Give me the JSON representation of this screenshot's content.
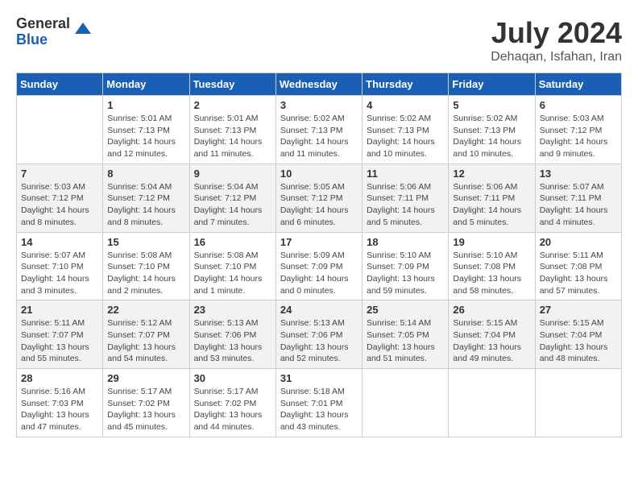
{
  "header": {
    "logo_general": "General",
    "logo_blue": "Blue",
    "month_year": "July 2024",
    "location": "Dehaqan, Isfahan, Iran"
  },
  "calendar": {
    "days_of_week": [
      "Sunday",
      "Monday",
      "Tuesday",
      "Wednesday",
      "Thursday",
      "Friday",
      "Saturday"
    ],
    "weeks": [
      [
        {
          "day": "",
          "info": ""
        },
        {
          "day": "1",
          "info": "Sunrise: 5:01 AM\nSunset: 7:13 PM\nDaylight: 14 hours\nand 12 minutes."
        },
        {
          "day": "2",
          "info": "Sunrise: 5:01 AM\nSunset: 7:13 PM\nDaylight: 14 hours\nand 11 minutes."
        },
        {
          "day": "3",
          "info": "Sunrise: 5:02 AM\nSunset: 7:13 PM\nDaylight: 14 hours\nand 11 minutes."
        },
        {
          "day": "4",
          "info": "Sunrise: 5:02 AM\nSunset: 7:13 PM\nDaylight: 14 hours\nand 10 minutes."
        },
        {
          "day": "5",
          "info": "Sunrise: 5:02 AM\nSunset: 7:13 PM\nDaylight: 14 hours\nand 10 minutes."
        },
        {
          "day": "6",
          "info": "Sunrise: 5:03 AM\nSunset: 7:12 PM\nDaylight: 14 hours\nand 9 minutes."
        }
      ],
      [
        {
          "day": "7",
          "info": "Sunrise: 5:03 AM\nSunset: 7:12 PM\nDaylight: 14 hours\nand 8 minutes."
        },
        {
          "day": "8",
          "info": "Sunrise: 5:04 AM\nSunset: 7:12 PM\nDaylight: 14 hours\nand 8 minutes."
        },
        {
          "day": "9",
          "info": "Sunrise: 5:04 AM\nSunset: 7:12 PM\nDaylight: 14 hours\nand 7 minutes."
        },
        {
          "day": "10",
          "info": "Sunrise: 5:05 AM\nSunset: 7:12 PM\nDaylight: 14 hours\nand 6 minutes."
        },
        {
          "day": "11",
          "info": "Sunrise: 5:06 AM\nSunset: 7:11 PM\nDaylight: 14 hours\nand 5 minutes."
        },
        {
          "day": "12",
          "info": "Sunrise: 5:06 AM\nSunset: 7:11 PM\nDaylight: 14 hours\nand 5 minutes."
        },
        {
          "day": "13",
          "info": "Sunrise: 5:07 AM\nSunset: 7:11 PM\nDaylight: 14 hours\nand 4 minutes."
        }
      ],
      [
        {
          "day": "14",
          "info": "Sunrise: 5:07 AM\nSunset: 7:10 PM\nDaylight: 14 hours\nand 3 minutes."
        },
        {
          "day": "15",
          "info": "Sunrise: 5:08 AM\nSunset: 7:10 PM\nDaylight: 14 hours\nand 2 minutes."
        },
        {
          "day": "16",
          "info": "Sunrise: 5:08 AM\nSunset: 7:10 PM\nDaylight: 14 hours\nand 1 minute."
        },
        {
          "day": "17",
          "info": "Sunrise: 5:09 AM\nSunset: 7:09 PM\nDaylight: 14 hours\nand 0 minutes."
        },
        {
          "day": "18",
          "info": "Sunrise: 5:10 AM\nSunset: 7:09 PM\nDaylight: 13 hours\nand 59 minutes."
        },
        {
          "day": "19",
          "info": "Sunrise: 5:10 AM\nSunset: 7:08 PM\nDaylight: 13 hours\nand 58 minutes."
        },
        {
          "day": "20",
          "info": "Sunrise: 5:11 AM\nSunset: 7:08 PM\nDaylight: 13 hours\nand 57 minutes."
        }
      ],
      [
        {
          "day": "21",
          "info": "Sunrise: 5:11 AM\nSunset: 7:07 PM\nDaylight: 13 hours\nand 55 minutes."
        },
        {
          "day": "22",
          "info": "Sunrise: 5:12 AM\nSunset: 7:07 PM\nDaylight: 13 hours\nand 54 minutes."
        },
        {
          "day": "23",
          "info": "Sunrise: 5:13 AM\nSunset: 7:06 PM\nDaylight: 13 hours\nand 53 minutes."
        },
        {
          "day": "24",
          "info": "Sunrise: 5:13 AM\nSunset: 7:06 PM\nDaylight: 13 hours\nand 52 minutes."
        },
        {
          "day": "25",
          "info": "Sunrise: 5:14 AM\nSunset: 7:05 PM\nDaylight: 13 hours\nand 51 minutes."
        },
        {
          "day": "26",
          "info": "Sunrise: 5:15 AM\nSunset: 7:04 PM\nDaylight: 13 hours\nand 49 minutes."
        },
        {
          "day": "27",
          "info": "Sunrise: 5:15 AM\nSunset: 7:04 PM\nDaylight: 13 hours\nand 48 minutes."
        }
      ],
      [
        {
          "day": "28",
          "info": "Sunrise: 5:16 AM\nSunset: 7:03 PM\nDaylight: 13 hours\nand 47 minutes."
        },
        {
          "day": "29",
          "info": "Sunrise: 5:17 AM\nSunset: 7:02 PM\nDaylight: 13 hours\nand 45 minutes."
        },
        {
          "day": "30",
          "info": "Sunrise: 5:17 AM\nSunset: 7:02 PM\nDaylight: 13 hours\nand 44 minutes."
        },
        {
          "day": "31",
          "info": "Sunrise: 5:18 AM\nSunset: 7:01 PM\nDaylight: 13 hours\nand 43 minutes."
        },
        {
          "day": "",
          "info": ""
        },
        {
          "day": "",
          "info": ""
        },
        {
          "day": "",
          "info": ""
        }
      ]
    ]
  }
}
